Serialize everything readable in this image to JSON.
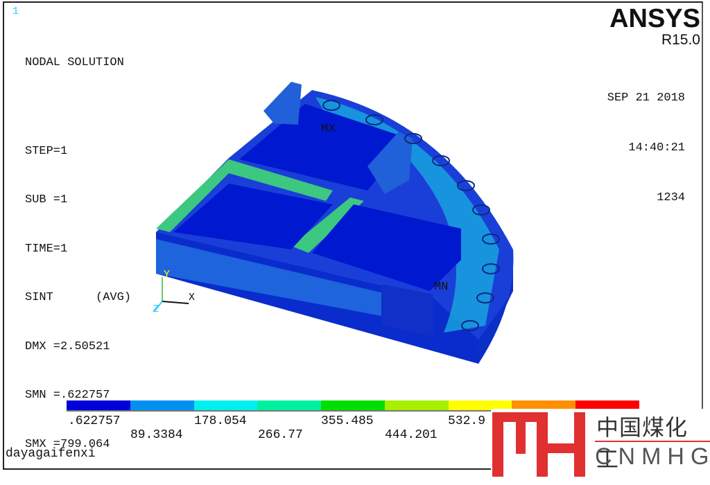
{
  "window_number": "1",
  "info": {
    "title": "NODAL SOLUTION",
    "step": "STEP=1",
    "sub": "SUB =1",
    "time": "TIME=1",
    "result": "SINT      (AVG)",
    "dmx": "DMX =2.50521",
    "smn": "SMN =.622757",
    "smx": "SMX =799.064"
  },
  "brand": {
    "name": "ANSYS",
    "release": "R15.0"
  },
  "stamp": {
    "date": "SEP 21 2018",
    "time": "14:40:21",
    "id": "1234"
  },
  "model_labels": {
    "mx": "MX",
    "mn": "MN",
    "axis_x": "X",
    "axis_y": "Y",
    "axis_z": "Z"
  },
  "legend": {
    "colors": [
      "#0000d8",
      "#0090f0",
      "#00f0f0",
      "#00f0a0",
      "#00e000",
      "#a8f000",
      "#ffff00",
      "#ff9000",
      "#ff0000"
    ],
    "labels_top": [
      ".622757",
      "178.054",
      "355.485",
      "532.9"
    ],
    "labels_bottom": [
      "89.3384",
      "266.77",
      "444.201"
    ]
  },
  "footer_title": "dayagaifenxi",
  "watermark": {
    "cn": "中国煤化工",
    "en": "CNMHG"
  }
}
